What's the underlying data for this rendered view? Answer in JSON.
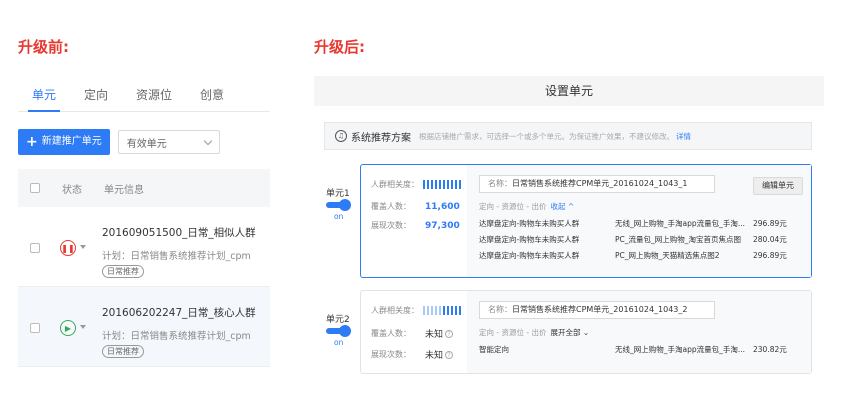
{
  "headings": {
    "before": "升级前:",
    "after": "升级后:"
  },
  "before": {
    "tabs": [
      {
        "label": "单元",
        "active": true
      },
      {
        "label": "定向",
        "active": false
      },
      {
        "label": "资源位",
        "active": false
      },
      {
        "label": "创意",
        "active": false
      }
    ],
    "new_button": "新建推广单元",
    "filter_select": "有效单元",
    "table_headers": {
      "status": "状态",
      "info": "单元信息"
    },
    "rows": [
      {
        "name": "201609051500_日常_相似人群",
        "plan": "计划：日常销售系统推荐计划_cpm",
        "tag": "日常推荐",
        "status": "paused"
      },
      {
        "name": "201606202247_日常_核心人群",
        "plan": "计划：日常销售系统推荐计划_cpm",
        "tag": "日常推荐",
        "status": "running"
      }
    ]
  },
  "after": {
    "title": "设置单元",
    "recommend": {
      "title": "系统推荐方案",
      "desc": "根据店铺推广需求，可选择一个或多个单元。为保证推广效果，不建议修改。",
      "link": "详情"
    },
    "labels": {
      "crowd": "人群相关度：",
      "coverage": "覆盖人数：",
      "impressions": "展现次数：",
      "name_key": "名称：",
      "sub_head": "定向 - 资源位 - 出价",
      "edit": "编辑单元"
    },
    "toggle_on": "on",
    "units": [
      {
        "label": "单元1",
        "name": "日常销售系统推荐CPM单元_20161024_1043_1",
        "coverage": "11,600",
        "impressions": "97,300",
        "toggle_link": "收起 ^",
        "details": [
          {
            "target": "达摩盘定向-购物车未购买人群",
            "position": "无线_网上购物_手淘app流量包_手淘...",
            "price": "296.89元"
          },
          {
            "target": "达摩盘定向-购物车未购买人群",
            "position": "PC_流量包_网上购物_淘宝首页焦点图",
            "price": "280.04元"
          },
          {
            "target": "达摩盘定向-购物车未购买人群",
            "position": "PC_网上购物_天猫精选焦点图2",
            "price": "296.89元"
          }
        ]
      },
      {
        "label": "单元2",
        "name": "日常销售系统推荐CPM单元_20161024_1043_2",
        "coverage": "未知",
        "impressions": "未知",
        "toggle_link": "展开全部 ⌄",
        "details": [
          {
            "target": "智能定向",
            "position": "无线_网上购物_手淘app流量包_手淘...",
            "price": "230.82元"
          }
        ]
      }
    ]
  },
  "colors": {
    "accent": "#2d7bf5",
    "heading": "#e8382f",
    "pause": "#e8382f",
    "play": "#3aa655"
  }
}
